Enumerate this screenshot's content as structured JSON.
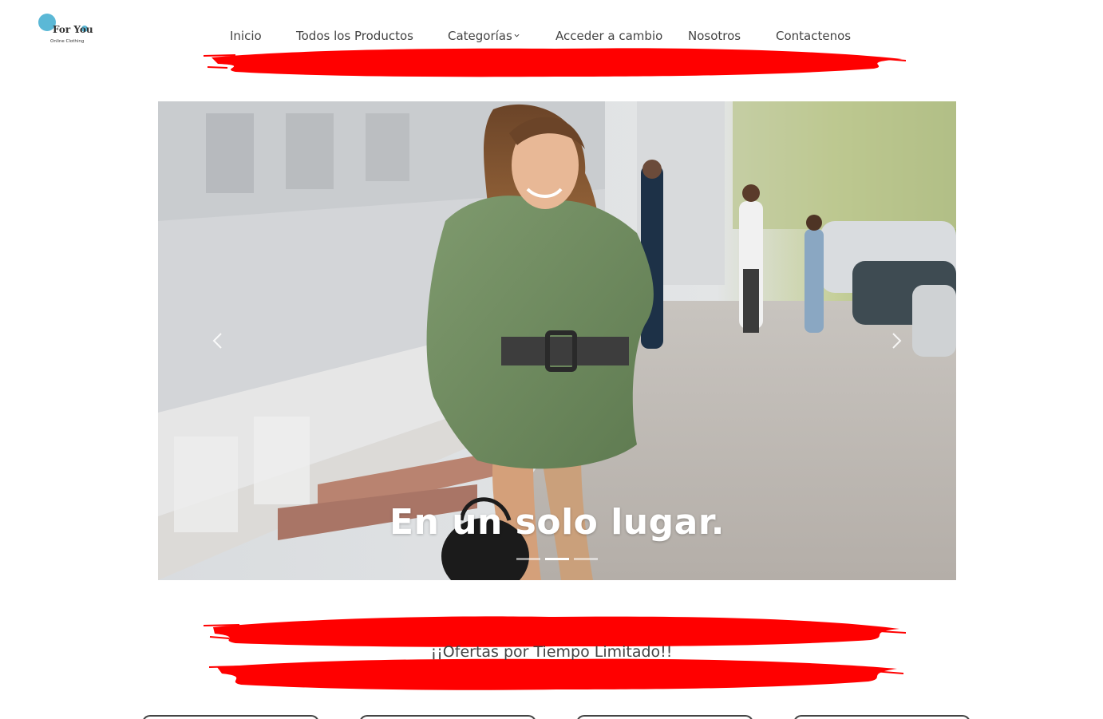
{
  "brand": {
    "name": "For You",
    "tagline": "Online Clothing"
  },
  "nav": {
    "items": [
      {
        "label": "Inicio"
      },
      {
        "label": "Todos los Productos"
      },
      {
        "label": "Categorías"
      },
      {
        "label": "Acceder a cambio"
      },
      {
        "label": "Nosotros"
      },
      {
        "label": "Contactenos"
      }
    ]
  },
  "hero": {
    "caption": "En un solo lugar.",
    "slides_count": 3,
    "active_slide": 2
  },
  "offers": {
    "title": "¡¡Ofertas por Tiempo Limitado!!"
  },
  "colors": {
    "accent": "#ff0000",
    "nav_text": "#444444",
    "caption_text": "#ffffff"
  },
  "icons": {
    "prev": "chevron-left-icon",
    "next": "chevron-right-icon",
    "dropdown": "chevron-down-icon"
  }
}
